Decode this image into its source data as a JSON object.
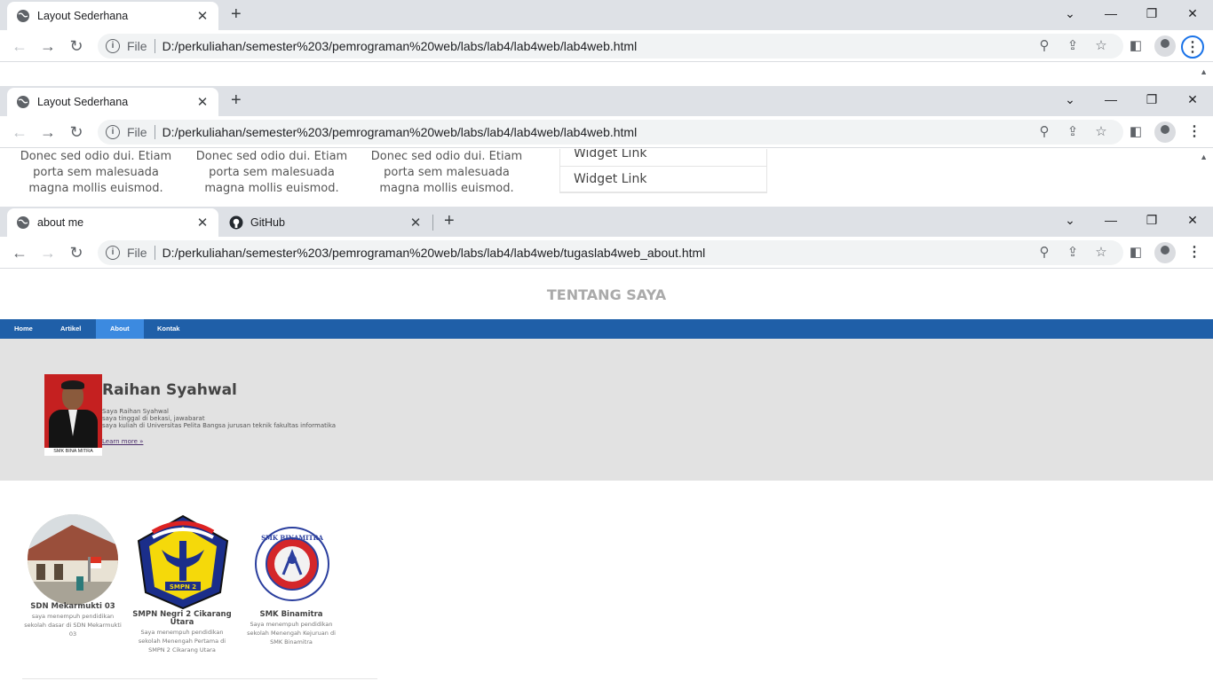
{
  "window1": {
    "tab_title": "Layout Sederhana",
    "url": "D:/perkuliahan/semester%203/pemrograman%20web/labs/lab4/lab4web/lab4web.html",
    "file_label": "File"
  },
  "window2": {
    "tab_title": "Layout Sederhana",
    "url": "D:/perkuliahan/semester%203/pemrograman%20web/labs/lab4/lab4web/lab4web.html",
    "file_label": "File",
    "columns": [
      "Donec sed odio dui. Etiam porta sem malesuada magna mollis euismod.",
      "Donec sed odio dui. Etiam porta sem malesuada magna mollis euismod.",
      "Donec sed odio dui. Etiam porta sem malesuada magna mollis euismod."
    ],
    "widget_links": [
      "Widget Link",
      "Widget Link"
    ]
  },
  "window3": {
    "tabs": [
      "about me",
      "GitHub"
    ],
    "url": "D:/perkuliahan/semester%203/pemrograman%20web/labs/lab4/lab4web/tugaslab4web_about.html",
    "file_label": "File",
    "page": {
      "heading": "TENTANG SAYA",
      "nav": [
        "Home",
        "Artikel",
        "About",
        "Kontak"
      ],
      "active_nav": "About",
      "profile": {
        "name": "Raihan Syahwal",
        "lines": [
          "Saya Raihan Syahwal",
          "saya tinggal di bekasi, jawabarat",
          "saya kuliah di Universitas Pelita Bangsa jurusan teknik fakultas informatika"
        ],
        "learn_more": "Learn more »",
        "photo_caption": "SMK BINA MITRA"
      },
      "schools": [
        {
          "name": "SDN Mekarmukti 03",
          "text": "saya menempuh pendidikan sekolah dasar di SDN Mekarmukti 03"
        },
        {
          "name": "SMPN Negri 2 Cikarang Utara",
          "text": "Saya menempuh pendidikan sekolah Menengah Pertama di SMPN 2 Cikarang Utara"
        },
        {
          "name": "SMK Binamitra",
          "text": "Saya menempuh pendidikan sekolah Menengah Kejuruan di SMK Binamitra"
        }
      ],
      "logo_text": {
        "smpn": "SMPN 2",
        "smk": "SMK BINAMITRA"
      }
    }
  },
  "colors": {
    "nav_bg": "#1f5fa8",
    "nav_active": "#3c8ae0",
    "hero_bg": "#e2e2e2",
    "tabstrip": "#dee1e6"
  }
}
